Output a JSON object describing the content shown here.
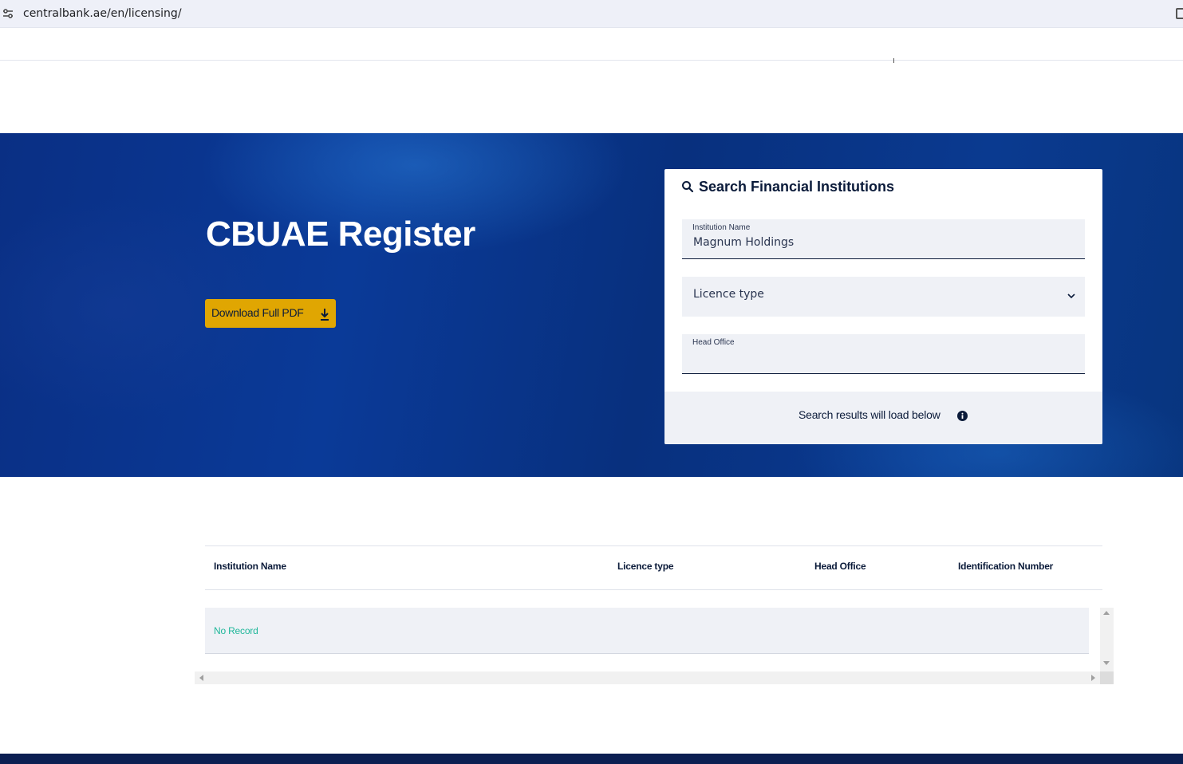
{
  "browser": {
    "url": "centralbank.ae/en/licensing/"
  },
  "hero": {
    "title": "CBUAE Register",
    "download_button": "Download Full PDF"
  },
  "search_card": {
    "title": "Search Financial Institutions",
    "institution_name": {
      "label": "Institution Name",
      "value": "Magnum Holdings"
    },
    "licence_type": {
      "selected": "Licence type"
    },
    "head_office": {
      "label": "Head Office",
      "value": ""
    },
    "footer_text": "Search results will load below"
  },
  "results_table": {
    "columns": [
      "Institution Name",
      "Licence type",
      "Head Office",
      "Identification Number"
    ],
    "empty_message": "No Record"
  },
  "colors": {
    "accent_gold": "#e0a602",
    "navy": "#0b1b3a",
    "hero_blue": "#0a3a98",
    "no_record_green": "#1fb79a"
  },
  "icons": [
    "site-settings-icon",
    "extension-icon",
    "download-icon",
    "search-icon",
    "chevron-down-icon",
    "info-icon"
  ]
}
